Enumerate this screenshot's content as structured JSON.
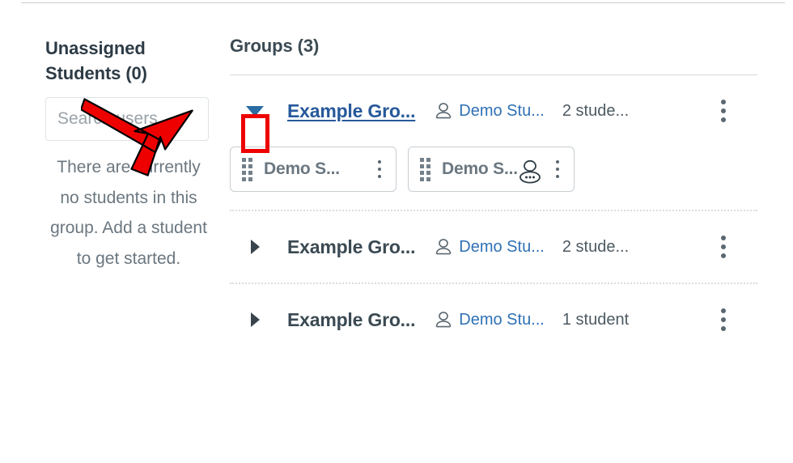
{
  "sidebar": {
    "title": "Unassigned Students (0)",
    "search": {
      "placeholder": "Search users",
      "value": ""
    },
    "empty_message": "There are currently no students in this group. Add a student to get started."
  },
  "main": {
    "title": "Groups (3)",
    "groups": [
      {
        "name": "Example Gro...",
        "expanded": true,
        "leader": "Demo Stu...",
        "student_count": "2 stude...",
        "highlighted": true,
        "members": [
          {
            "name": "Demo S...",
            "has_cursor_icon": false
          },
          {
            "name": "Demo S...",
            "has_cursor_icon": true
          }
        ]
      },
      {
        "name": "Example Gro...",
        "expanded": false,
        "leader": "Demo Stu...",
        "student_count": "2 stude...",
        "highlighted": false,
        "members": []
      },
      {
        "name": "Example Gro...",
        "expanded": false,
        "leader": "Demo Stu...",
        "student_count": "1 student",
        "highlighted": false,
        "members": []
      }
    ]
  },
  "annotations": {
    "arrow_color": "#ee0000",
    "highlight_color": "#ee0000",
    "arrow_target": "expand-collapse-toggle"
  },
  "colors": {
    "link": "#27599b",
    "leader_link": "#2f70b5",
    "text": "#2d3b45",
    "muted": "#6b7780",
    "border": "#c7cdd1"
  },
  "icons": {
    "toggle_expanded": "caret-down-icon",
    "toggle_collapsed": "caret-right-icon",
    "leader": "person-icon",
    "menu": "kebab-menu-icon",
    "drag": "drag-handle-icon"
  }
}
